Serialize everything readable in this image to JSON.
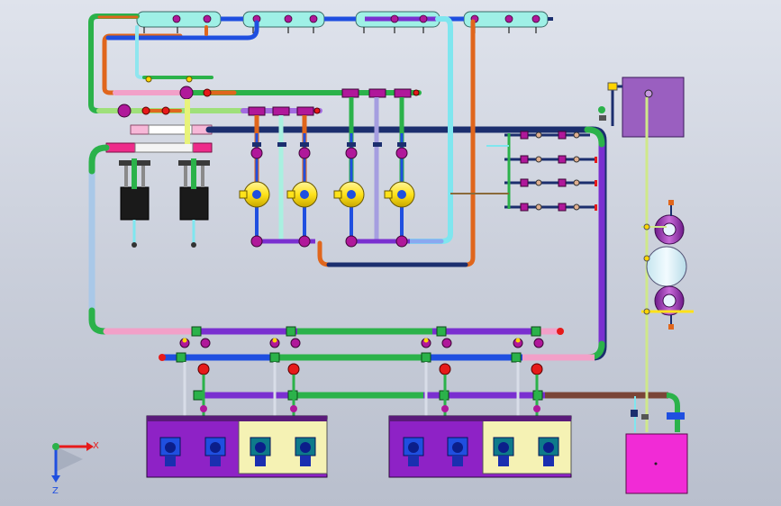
{
  "colors": {
    "pipe_blue": "#1f4fe0",
    "pipe_navy": "#1b2e6e",
    "pipe_green": "#2bb24a",
    "pipe_teal": "#6fd6c8",
    "pipe_orange": "#e0661c",
    "pipe_purple": "#7a2fd0",
    "pipe_pink": "#f2a0c8",
    "pipe_magenta": "#ee2b8a",
    "pipe_lightblue": "#a9c8e8",
    "pipe_cyan": "#7fe6ef",
    "pipe_brown": "#7a4538",
    "pipe_lime": "#9fe07a",
    "pipe_yellowgreen": "#cfe88a",
    "tank_violet": "#9a5fc0",
    "tank_magenta": "#f12bd6",
    "pump_yellow": "#ffe21a",
    "skid_purple": "#8e22c6",
    "skid_cream": "#f5f2b4",
    "valve_magenta": "#b0189a",
    "valve_red": "#e61a1a"
  },
  "icons": {
    "triad": "coordinate-triad-icon",
    "valve": "valve-icon",
    "pump": "pump-icon",
    "tank": "tank-icon",
    "motor": "motor-icon"
  },
  "axes": {
    "x_label": "X",
    "z_label": "Z"
  }
}
